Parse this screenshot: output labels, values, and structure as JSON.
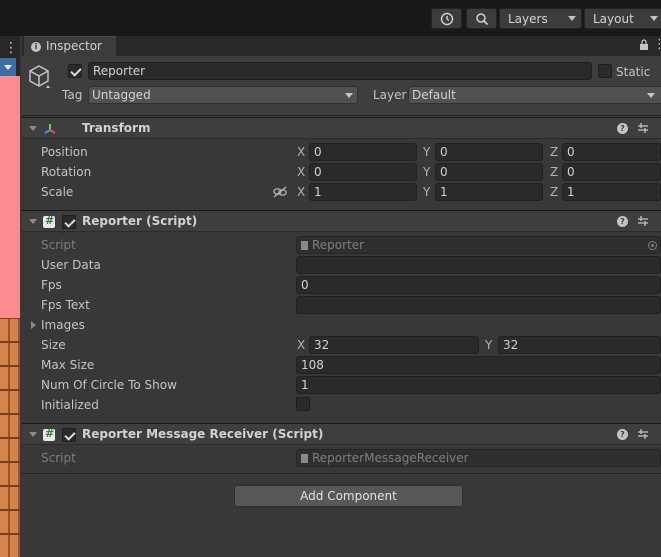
{
  "toolbar": {
    "history_icon": "history-icon",
    "search_icon": "search-icon",
    "layers_label": "Layers",
    "layout_label": "Layout"
  },
  "inspector": {
    "tab_label": "Inspector",
    "object": {
      "active": true,
      "name": "Reporter",
      "static_label": "Static",
      "static": false,
      "tag_label": "Tag",
      "tag_value": "Untagged",
      "layer_label": "Layer",
      "layer_value": "Default"
    },
    "transform": {
      "title": "Transform",
      "position": {
        "label": "Position",
        "x": "0",
        "y": "0",
        "z": "0"
      },
      "rotation": {
        "label": "Rotation",
        "x": "0",
        "y": "0",
        "z": "0"
      },
      "scale": {
        "label": "Scale",
        "x": "1",
        "y": "1",
        "z": "1"
      },
      "axis_x": "X",
      "axis_y": "Y",
      "axis_z": "Z"
    },
    "reporter_script": {
      "title": "Reporter (Script)",
      "enabled": true,
      "fields": {
        "script_label": "Script",
        "script_value": "Reporter",
        "user_data_label": "User Data",
        "user_data_value": "",
        "fps_label": "Fps",
        "fps_value": "0",
        "fps_text_label": "Fps Text",
        "fps_text_value": "",
        "images_label": "Images",
        "size_label": "Size",
        "size_x": "32",
        "size_y": "32",
        "max_size_label": "Max Size",
        "max_size_value": "108",
        "num_circle_label": "Num Of Circle To Show",
        "num_circle_value": "1",
        "initialized_label": "Initialized",
        "initialized": false
      }
    },
    "receiver_script": {
      "title": "Reporter Message Receiver (Script)",
      "enabled": true,
      "script_label": "Script",
      "script_value": "ReporterMessageReceiver"
    },
    "add_component_label": "Add Component"
  }
}
